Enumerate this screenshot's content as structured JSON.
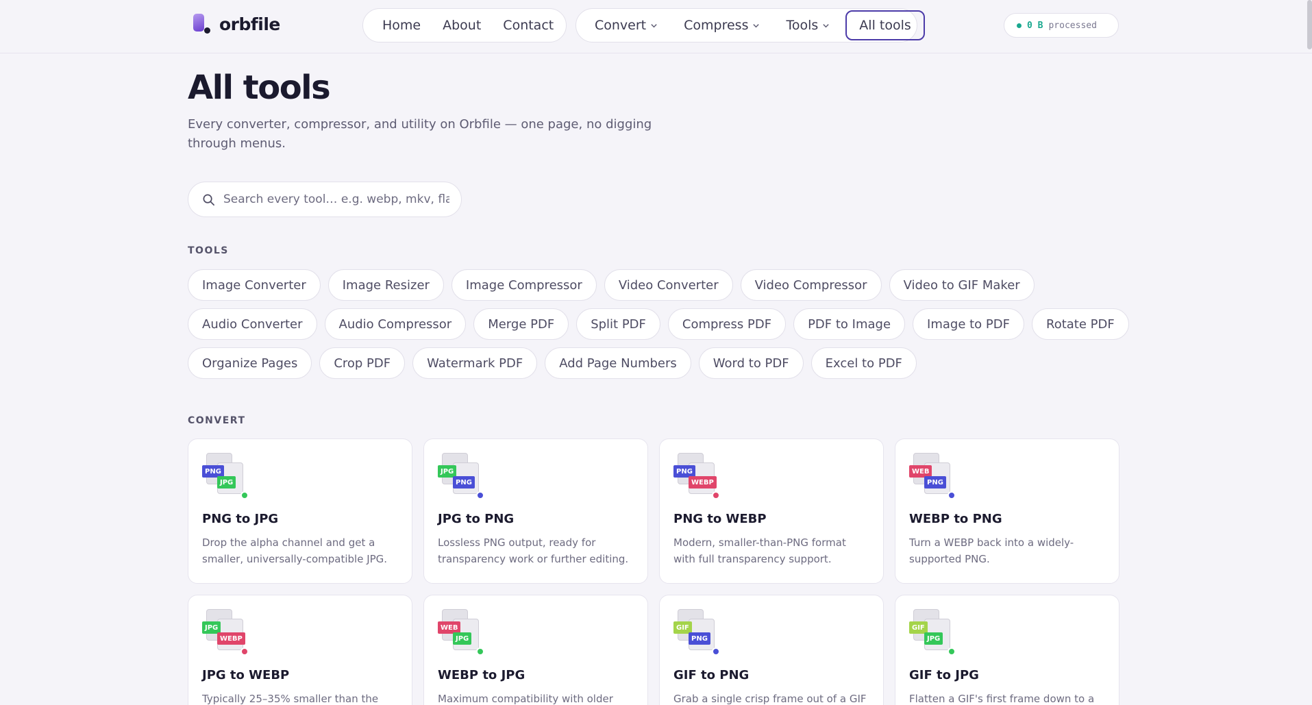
{
  "app": {
    "name": "orbfile"
  },
  "nav": {
    "primary": [
      "Home",
      "About",
      "Contact"
    ],
    "menus": [
      "Convert",
      "Compress",
      "Tools"
    ],
    "all_tools": "All tools"
  },
  "status": {
    "value": "0 B",
    "label": "processed",
    "color": "#19a88f"
  },
  "page": {
    "title": "All tools",
    "subtitle": "Every converter, compressor, and utility on Orbfile — one page, no digging through menus."
  },
  "search": {
    "placeholder": "Search every tool… e.g. webp, mkv, flac",
    "value": ""
  },
  "tools_section": {
    "label": "TOOLS",
    "rows": [
      [
        "Image Converter",
        "Image Resizer",
        "Image Compressor",
        "Video Converter",
        "Video Compressor",
        "Video to GIF Maker"
      ],
      [
        "Audio Converter",
        "Audio Compressor",
        "Merge PDF",
        "Split PDF",
        "Compress PDF",
        "PDF to Image",
        "Image to PDF",
        "Rotate PDF"
      ],
      [
        "Organize Pages",
        "Crop PDF",
        "Watermark PDF",
        "Add Page Numbers",
        "Word to PDF",
        "Excel to PDF"
      ]
    ]
  },
  "convert_section": {
    "label": "CONVERT",
    "cards": [
      {
        "title": "PNG to JPG",
        "desc": "Drop the alpha channel and get a smaller, universally-compatible JPG.",
        "from": "PNG",
        "to": "JPG",
        "from_color": "#4a4fd6",
        "to_color": "#34c759"
      },
      {
        "title": "JPG to PNG",
        "desc": "Lossless PNG output, ready for transparency work or further editing.",
        "from": "JPG",
        "to": "PNG",
        "from_color": "#34c759",
        "to_color": "#4a4fd6"
      },
      {
        "title": "PNG to WEBP",
        "desc": "Modern, smaller-than-PNG format with full transparency support.",
        "from": "PNG",
        "to": "WEBP",
        "from_color": "#4a4fd6",
        "to_color": "#e0456a"
      },
      {
        "title": "WEBP to PNG",
        "desc": "Turn a WEBP back into a widely-supported PNG.",
        "from": "WEB",
        "to": "PNG",
        "from_color": "#e0456a",
        "to_color": "#4a4fd6"
      },
      {
        "title": "JPG to WEBP",
        "desc": "Typically 25–35% smaller than the",
        "from": "JPG",
        "to": "WEBP",
        "from_color": "#34c759",
        "to_color": "#e0456a"
      },
      {
        "title": "WEBP to JPG",
        "desc": "Maximum compatibility with older apps.",
        "from": "WEB",
        "to": "JPG",
        "from_color": "#e0456a",
        "to_color": "#34c759"
      },
      {
        "title": "GIF to PNG",
        "desc": "Grab a single crisp frame out of a GIF as",
        "from": "GIF",
        "to": "PNG",
        "from_color": "#a4d44a",
        "to_color": "#4a4fd6"
      },
      {
        "title": "GIF to JPG",
        "desc": "Flatten a GIF's first frame down to a",
        "from": "GIF",
        "to": "JPG",
        "from_color": "#a4d44a",
        "to_color": "#34c759"
      }
    ]
  },
  "icons": [
    "logo-icon",
    "chevron-down-icon",
    "search-icon",
    "file-convert-icon"
  ]
}
